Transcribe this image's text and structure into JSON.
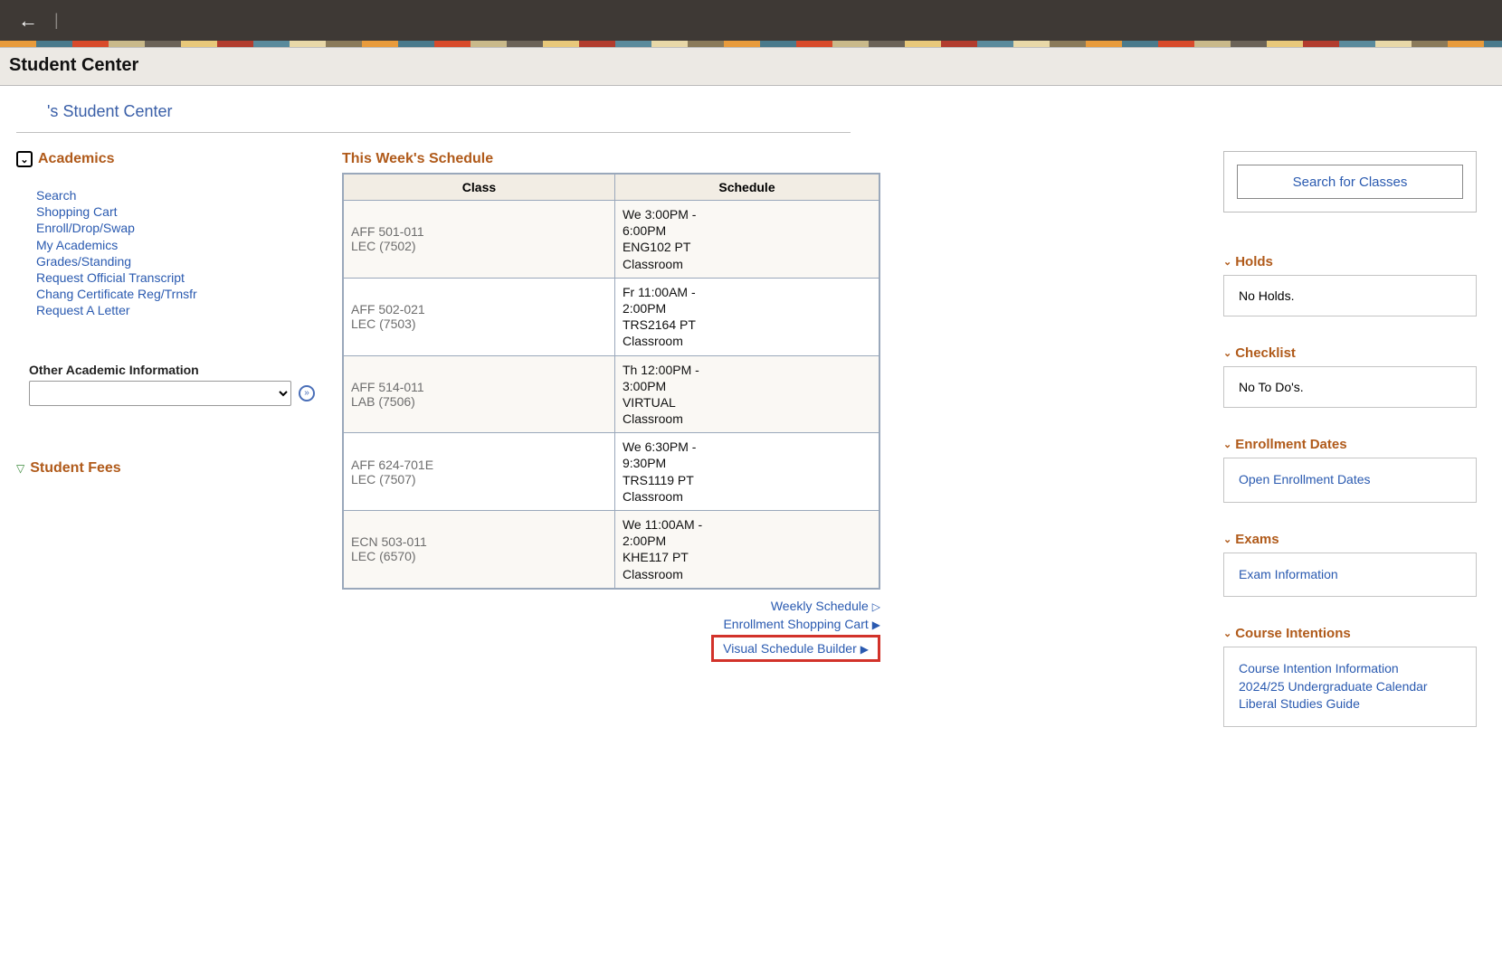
{
  "titlebar": "Student Center",
  "subhead": "'s Student Center",
  "academics": {
    "heading": "Academics",
    "links": [
      "Search",
      "Shopping Cart",
      "Enroll/Drop/Swap",
      "My Academics",
      "Grades/Standing",
      "Request Official Transcript",
      "Chang Certificate Reg/Trnsfr",
      "Request A Letter"
    ],
    "other_label": "Other Academic Information"
  },
  "schedule": {
    "title": "This Week's Schedule",
    "col_class": "Class",
    "col_sched": "Schedule",
    "rows": [
      {
        "class": "AFF 501-011\nLEC (7502)",
        "sched": "We 3:00PM -\n6:00PM\nENG102 PT\nClassroom"
      },
      {
        "class": "AFF 502-021\nLEC (7503)",
        "sched": "Fr 11:00AM -\n2:00PM\nTRS2164 PT\nClassroom"
      },
      {
        "class": "AFF 514-011\nLAB (7506)",
        "sched": "Th 12:00PM -\n3:00PM\nVIRTUAL\nClassroom"
      },
      {
        "class": "AFF 624-701E\nLEC (7507)",
        "sched": "We 6:30PM -\n9:30PM\nTRS1119 PT\nClassroom"
      },
      {
        "class": "ECN 503-011\nLEC (6570)",
        "sched": "We 11:00AM -\n2:00PM\nKHE117 PT\nClassroom"
      }
    ],
    "link_weekly": "Weekly Schedule",
    "link_cart": "Enrollment Shopping Cart",
    "link_vsb": "Visual Schedule Builder"
  },
  "sidebar": {
    "search_btn": "Search for Classes",
    "holds_head": "Holds",
    "holds_body": "No Holds.",
    "checklist_head": "Checklist",
    "checklist_body": "No To Do's.",
    "enroll_head": "Enrollment Dates",
    "enroll_link": "Open Enrollment Dates",
    "exams_head": "Exams",
    "exams_link": "Exam Information",
    "intentions_head": "Course Intentions",
    "intentions_links": [
      "Course Intention Information",
      "2024/25 Undergraduate Calendar",
      "Liberal Studies Guide"
    ]
  },
  "fees_head": "Student Fees"
}
